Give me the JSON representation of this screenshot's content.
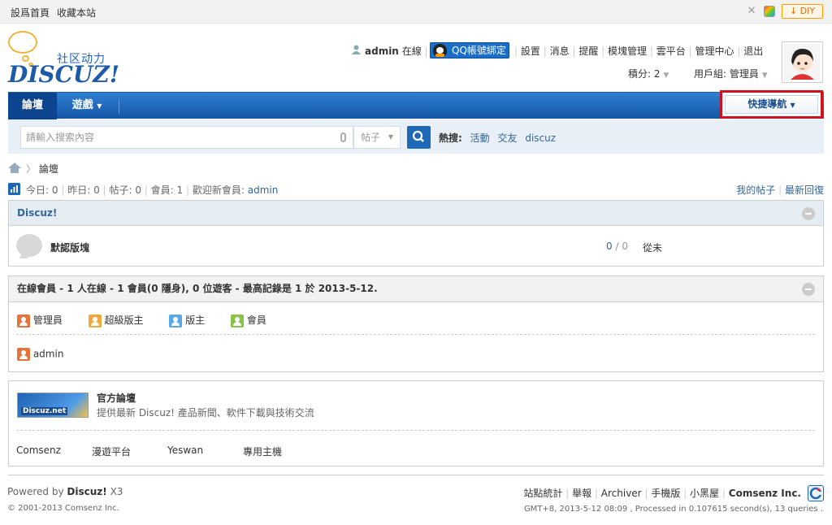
{
  "topbar": {
    "links": [
      "設爲首頁",
      "收藏本站"
    ],
    "diy_label": "DIY"
  },
  "logo": {
    "cn": "社区动力",
    "en": "DISCUZ!"
  },
  "usermenu": {
    "username": "admin",
    "status": "在線",
    "qq_label": "QQ帳號綁定",
    "links": [
      "設置",
      "消息",
      "提醒",
      "模塊管理",
      "雲平台",
      "管理中心",
      "退出"
    ],
    "credits": "積分: 2",
    "group": "用戶組: 管理員"
  },
  "nav": {
    "items": [
      "論壇",
      "遊戲"
    ],
    "quick_nav": "快捷導航"
  },
  "search": {
    "placeholder": "請輸入搜索內容",
    "type": "帖子",
    "hot_label": "熱搜:",
    "hot": [
      "活動",
      "交友",
      "discuz"
    ]
  },
  "breadcrumb": {
    "current": "論壇"
  },
  "stats": {
    "today_label": "今日:",
    "today": "0",
    "yesterday_label": "昨日:",
    "yesterday": "0",
    "posts_label": "帖子:",
    "posts": "0",
    "members_label": "會員:",
    "members": "1",
    "newest_label": "歡迎新會員:",
    "newest": "admin",
    "my_posts": "我的帖子",
    "latest_replies": "最新回復"
  },
  "category": {
    "title": "Discuz!",
    "forum_name": "默認版塊",
    "threads": "0",
    "divider": "/",
    "replies": "0",
    "last_post": "從未"
  },
  "online": {
    "header": "在線會員 - 1 人在線 - 1 會員(0 隱身), 0 位遊客 - 最高記錄是 1 於 2013-5-12.",
    "legend": [
      {
        "label": "管理員",
        "color": "#e8723c"
      },
      {
        "label": "超級版主",
        "color": "#f0a93b"
      },
      {
        "label": "版主",
        "color": "#5aa7e6"
      },
      {
        "label": "會員",
        "color": "#8bc34a"
      }
    ],
    "users": [
      "admin"
    ]
  },
  "links_box": {
    "logo_text": "Discuz.net",
    "title": "官方論壇",
    "desc": "提供最新 Discuz! 產品新聞、軟件下載與技術交流",
    "friends": [
      "Comsenz",
      "漫遊平台",
      "Yeswan",
      "專用主機"
    ]
  },
  "footer": {
    "powered_prefix": "Powered by",
    "powered_name": "Discuz!",
    "powered_ver": "X3",
    "links": [
      "站點統計",
      "舉報",
      "Archiver",
      "手機版",
      "小黑屋"
    ],
    "company": "Comsenz Inc.",
    "copyright": "© 2001-2013 Comsenz Inc.",
    "debug": "GMT+8, 2013-5-12 08:09 , Processed in 0.107615 second(s), 13 queries ."
  }
}
